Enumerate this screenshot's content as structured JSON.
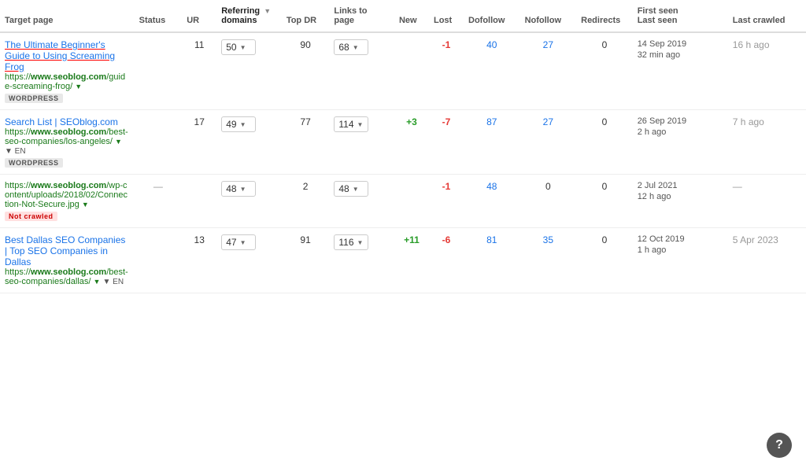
{
  "table": {
    "columns": [
      {
        "label": "Target page",
        "key": "target",
        "class": "col-target"
      },
      {
        "label": "Status",
        "key": "status",
        "class": "col-status"
      },
      {
        "label": "UR",
        "key": "ur",
        "class": "col-ur"
      },
      {
        "label": "Referring ▼\ndomains",
        "key": "ref_domains",
        "class": "col-ref-domains",
        "sortable": true
      },
      {
        "label": "Top DR",
        "key": "top_dr",
        "class": "col-top-dr"
      },
      {
        "label": "Links to page",
        "key": "links_to_page",
        "class": "col-links"
      },
      {
        "label": "New",
        "key": "new",
        "class": "col-new"
      },
      {
        "label": "Lost",
        "key": "lost",
        "class": "col-lost"
      },
      {
        "label": "Dofollow",
        "key": "dofollow",
        "class": "col-dofollow"
      },
      {
        "label": "Nofollow",
        "key": "nofollow",
        "class": "col-nofollow"
      },
      {
        "label": "Redirects",
        "key": "redirects",
        "class": "col-redirects"
      },
      {
        "label": "First seen\nLast seen",
        "key": "first_last",
        "class": "col-first-last"
      },
      {
        "label": "Last crawled",
        "key": "last_crawled",
        "class": "col-last-crawled"
      }
    ],
    "rows": [
      {
        "id": 1,
        "target_title": "The Ultimate Beginner's Guide to Using Screaming Frog",
        "target_title_underline": true,
        "url_prefix": "https://",
        "url_domain": "www.seoblog.com",
        "url_suffix": "/guide-screaming-frog/",
        "url_has_dropdown": true,
        "badge": "WORDPRESS",
        "badge_type": "normal",
        "status": "",
        "ur": 11,
        "ref_domains_val": 50,
        "top_dr": 90,
        "links_to_page": 68,
        "new": "",
        "lost": "-1",
        "lost_color": "red",
        "dofollow": 40,
        "dofollow_color": "blue",
        "nofollow": 27,
        "nofollow_color": "blue",
        "redirects": 0,
        "first_seen": "14 Sep 2019",
        "last_seen": "32 min ago",
        "last_crawled": "16 h ago"
      },
      {
        "id": 2,
        "target_title": "Search List | SEOblog.com",
        "target_title_underline": false,
        "url_prefix": "https://",
        "url_domain": "www.seoblog.com",
        "url_suffix": "/best-seo-companies/los-angeles/",
        "url_has_dropdown": true,
        "url_flag": "EN",
        "badge": "WORDPRESS",
        "badge_type": "normal",
        "status": "",
        "ur": 17,
        "ref_domains_val": 49,
        "top_dr": 77,
        "links_to_page": 114,
        "new": "+3",
        "new_color": "green",
        "lost": "-7",
        "lost_color": "red",
        "dofollow": 87,
        "dofollow_color": "blue",
        "nofollow": 27,
        "nofollow_color": "blue",
        "redirects": 0,
        "first_seen": "26 Sep 2019",
        "last_seen": "2 h ago",
        "last_crawled": "7 h ago"
      },
      {
        "id": 3,
        "target_title": "",
        "target_title_underline": false,
        "url_prefix": "https://",
        "url_domain": "www.seoblog.com",
        "url_suffix": "/wp-content/uploads/2018/02/Connection-Not-Secure.jpg",
        "url_has_dropdown": true,
        "badge": "Not crawled",
        "badge_type": "not-crawled",
        "status": "—",
        "ur": "",
        "ref_domains_val": 48,
        "top_dr": 2,
        "links_to_page": 48,
        "new": "",
        "lost": "-1",
        "lost_color": "red",
        "dofollow": 48,
        "dofollow_color": "blue",
        "nofollow": 0,
        "nofollow_color": "normal",
        "redirects": 0,
        "first_seen": "2 Jul 2021",
        "last_seen": "12 h ago",
        "last_crawled": "—"
      },
      {
        "id": 4,
        "target_title": "Best Dallas SEO Companies | Top SEO Companies in Dallas",
        "target_title_underline": false,
        "url_prefix": "https://",
        "url_domain": "www.seoblog.com",
        "url_suffix": "/best-seo-companies/dall as/",
        "url_suffix_display": "/best-seo-companies/dallas/",
        "url_has_dropdown": true,
        "url_flag": "EN",
        "badge": "",
        "badge_type": "normal",
        "status": "",
        "ur": 13,
        "ref_domains_val": 47,
        "top_dr": 91,
        "links_to_page": 116,
        "new": "+11",
        "new_color": "green",
        "lost": "-6",
        "lost_color": "red",
        "dofollow": 81,
        "dofollow_color": "blue",
        "nofollow": 35,
        "nofollow_color": "blue",
        "redirects": 0,
        "first_seen": "12 Oct 2019",
        "last_seen": "1 h ago",
        "last_crawled": "5 Apr 2023"
      }
    ]
  },
  "help_button": "?"
}
